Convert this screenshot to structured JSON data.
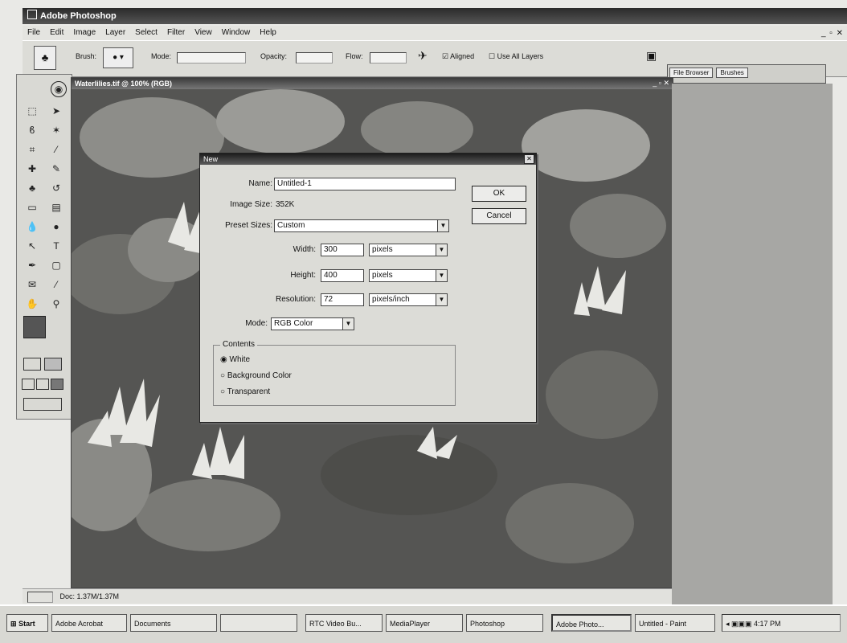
{
  "app": {
    "title": "Adobe Photoshop"
  },
  "menu": [
    "File",
    "Edit",
    "Image",
    "Layer",
    "Select",
    "Filter",
    "View",
    "Window",
    "Help"
  ],
  "options_bar": {
    "brush_label": "Brush:",
    "mode_label": "Mode:",
    "opacity_label": "Opacity:",
    "flow_label": "Flow:",
    "aligned_label": "Aligned",
    "use_all_layers_label": "Use All Layers"
  },
  "palette_well": {
    "tabs": [
      "File Browser",
      "Brushes"
    ]
  },
  "document": {
    "title": "Waterlilies.tif @ 100% (RGB)"
  },
  "status_bar": {
    "doc_info": "Doc: 1.37M/1.37M"
  },
  "dialog": {
    "title": "New",
    "name_label": "Name:",
    "name_value": "Untitled-1",
    "image_size_label": "Image Size:",
    "image_size_value": "352K",
    "preset_label": "Preset Sizes:",
    "preset_value": "Custom",
    "width_label": "Width:",
    "width_value": "300",
    "width_unit": "pixels",
    "height_label": "Height:",
    "height_value": "400",
    "height_unit": "pixels",
    "resolution_label": "Resolution:",
    "resolution_value": "72",
    "resolution_unit": "pixels/inch",
    "mode_label": "Mode:",
    "mode_value": "RGB Color",
    "contents_label": "Contents",
    "contents_options": [
      "White",
      "Background Color",
      "Transparent"
    ],
    "ok_label": "OK",
    "cancel_label": "Cancel"
  },
  "taskbar": {
    "start_label": "Start",
    "items": [
      "Adobe Acrobat",
      "Documents",
      "",
      "RTC Video Bu...",
      "MediaPlayer",
      "Photoshop",
      "Adobe Photo...",
      "Untitled - Paint"
    ],
    "clock": "4:17 PM"
  },
  "colors": {
    "titlebar": "#2a2a2a",
    "dialog_bg": "#dcdcd7",
    "workspace": "#a7a7a4"
  }
}
